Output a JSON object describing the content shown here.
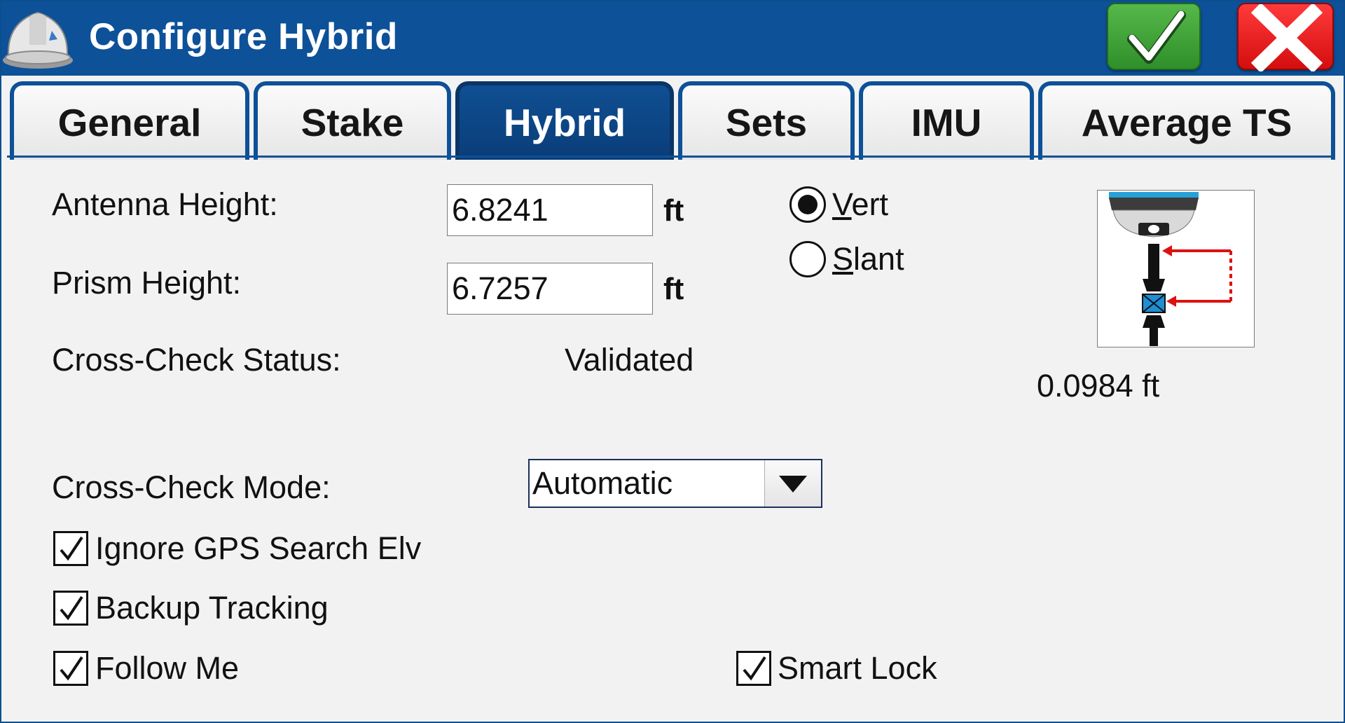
{
  "window": {
    "title": "Configure Hybrid",
    "title_bar_color": "#0d5198",
    "ok_icon": "checkmark-icon",
    "cancel_icon": "x-icon"
  },
  "tabs": [
    {
      "label": "General",
      "active": false
    },
    {
      "label": "Stake",
      "active": false
    },
    {
      "label": "Hybrid",
      "active": true
    },
    {
      "label": "Sets",
      "active": false
    },
    {
      "label": "IMU",
      "active": false
    },
    {
      "label": "Average TS",
      "active": false
    }
  ],
  "form": {
    "antenna_height_label": "Antenna Height:",
    "antenna_height_value": "6.8241",
    "antenna_height_unit": "ft",
    "prism_height_label": "Prism Height:",
    "prism_height_value": "6.7257",
    "prism_height_unit": "ft",
    "cross_check_status_label": "Cross-Check Status:",
    "cross_check_status_value": "Validated",
    "cross_check_mode_label": "Cross-Check Mode:",
    "cross_check_mode_value": "Automatic",
    "offset_value": "0.0984 ft"
  },
  "measure_type": {
    "vert_label_underlined": "V",
    "vert_label_rest": "ert",
    "slant_label_underlined": "S",
    "slant_label_rest": "lant",
    "selected": "Vert"
  },
  "checkboxes": {
    "ignore_gps": {
      "label": "Ignore GPS Search Elv",
      "checked": true
    },
    "backup_tracking": {
      "label": "Backup Tracking",
      "checked": true
    },
    "follow_me": {
      "label": "Follow Me",
      "checked": true
    },
    "smart_lock": {
      "label": "Smart Lock",
      "checked": true
    }
  }
}
